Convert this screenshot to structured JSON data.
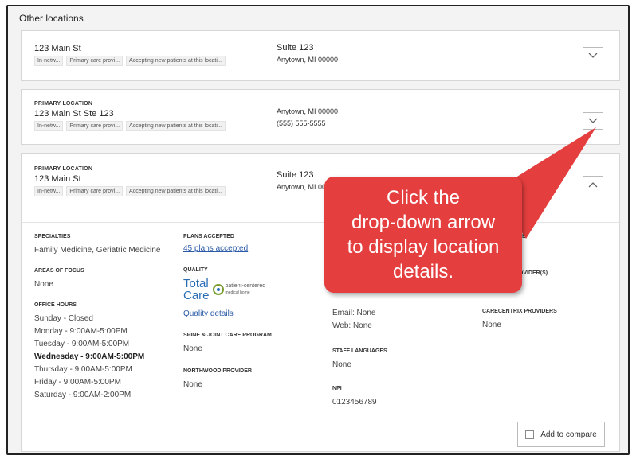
{
  "section_title": "Other locations",
  "cards": [
    {
      "primary_label": "",
      "address": "123 Main St",
      "tags": [
        "In-netw...",
        "Primary care provi...",
        "Accepting new patients at this locati..."
      ],
      "mid_line1": "Suite 123",
      "mid_line2": "Anytown, MI 00000",
      "toggle_icon": "chevron-down-icon"
    },
    {
      "primary_label": "PRIMARY LOCATION",
      "address": "123 Main St Ste 123",
      "tags": [
        "In-netw...",
        "Primary care provi...",
        "Accepting new patients at this locati..."
      ],
      "mid_line1": "Anytown, MI 00000",
      "mid_line2": "(555) 555-5555",
      "toggle_icon": "chevron-down-icon"
    },
    {
      "primary_label": "PRIMARY LOCATION",
      "address": "123 Main St",
      "tags": [
        "In-netw...",
        "Primary care provi...",
        "Accepting new patients at this locati..."
      ],
      "mid_line1": "Suite 123",
      "mid_line2": "Anytown, MI 00",
      "toggle_icon": "chevron-up-icon"
    }
  ],
  "details": {
    "specialties_heading": "SPECIALTIES",
    "specialties_value": "Family Medicine,  Geriatric Medicine",
    "areas_heading": "AREAS OF FOCUS",
    "areas_value": "None",
    "hours_heading": "OFFICE HOURS",
    "hours": [
      "Sunday - Closed",
      "Monday - 9:00AM-5:00PM",
      "Tuesday - 9:00AM-5:00PM",
      "Wednesday - 9:00AM-5:00PM",
      "Thursday - 9:00AM-5:00PM",
      "Friday - 9:00AM-5:00PM",
      "Saturday - 9:00AM-2:00PM"
    ],
    "plans_heading": "PLANS ACCEPTED",
    "plans_link": "45 plans accepted",
    "quality_heading": "QUALITY",
    "total_care_line1": "Total",
    "total_care_line2": "Care",
    "patient_centered_line1": "patient-centered",
    "patient_centered_line2": "medical home",
    "quality_link": "Quality details",
    "spine_heading": "SPINE & JOINT CARE PROGRAM",
    "spine_value": "None",
    "northwood_heading": "NORTHWOOD PROVIDER",
    "northwood_value": "None",
    "email_value": "Email: None",
    "web_value": "Web: None",
    "staff_heading": "STAFF LANGUAGES",
    "staff_value": "None",
    "npi_heading": "NPI",
    "npi_value": "0123456789",
    "col4_partial_heading": "E",
    "surgery_heading": "SURGERY PROVIDER(S)",
    "carecentrix_heading": "CARECENTRIX PROVIDERS",
    "carecentrix_value": "None",
    "compare_label": "Add to compare"
  },
  "callout": {
    "line1": "Click the",
    "line2": "drop-down arrow",
    "line3": "to display location",
    "line4": "details.",
    "color": "#e53e3e"
  }
}
